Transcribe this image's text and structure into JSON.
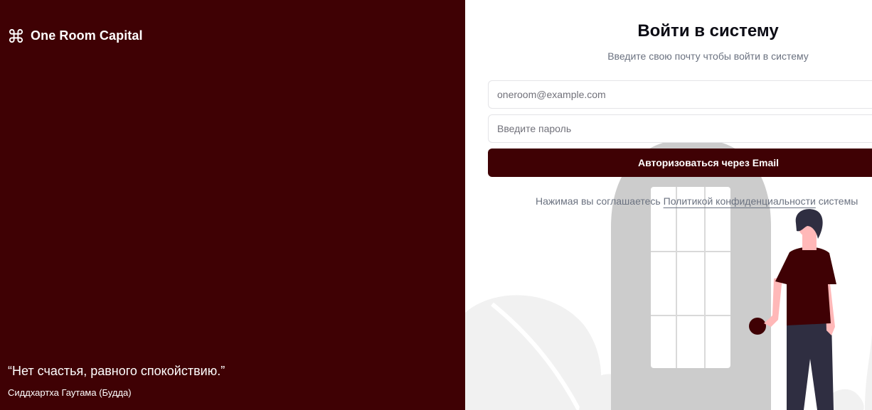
{
  "brand": {
    "name": "One Room Capital",
    "icon": "command-icon"
  },
  "quote": {
    "text": "“Нет счастья, равного спокойствию.”",
    "author": "Сиддхартха Гаутама (Будда)"
  },
  "login": {
    "title": "Войти в систему",
    "subtitle": "Введите свою почту чтобы войти в систему",
    "email_placeholder": "oneroom@example.com",
    "password_placeholder": "Введите пароль",
    "submit_label": "Авторизоваться через Email",
    "terms_prefix": "Нажимая вы соглашаетесь ",
    "terms_link": "Политикой конфиденциальности",
    "terms_suffix": " системы"
  },
  "colors": {
    "brand": "#3f0104",
    "background": "#ffffff",
    "muted_text": "#6b7280",
    "illustration_gray": "#cccccc"
  }
}
